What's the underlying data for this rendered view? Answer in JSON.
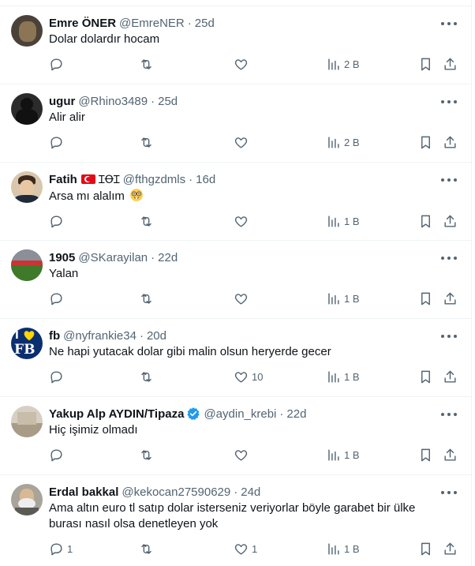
{
  "tweets": [
    {
      "name": "Emre ÖNER",
      "handle": "@EmreNER",
      "time": "25d",
      "text": "Dolar dolardır hocam",
      "replies": "",
      "retweets": "",
      "likes": "",
      "views": "2 B",
      "avatar_color": "#4a4238"
    },
    {
      "name": "ugur",
      "handle": "@Rhino3489",
      "time": "25d",
      "text": "Alir alir",
      "replies": "",
      "retweets": "",
      "likes": "",
      "views": "2 B",
      "avatar_color": "#2b2b2b"
    },
    {
      "name": "Fatih",
      "name_suffix": "ꞮꝊꞮ",
      "handle": "@fthgzdmls",
      "time": "16d",
      "text": "Arsa mı alalım",
      "replies": "",
      "retweets": "",
      "likes": "",
      "views": "1 B",
      "avatar_color": "#c9b59a"
    },
    {
      "name": "1905",
      "handle": "@SKarayilan",
      "time": "22d",
      "text": "Yalan",
      "replies": "",
      "retweets": "",
      "likes": "",
      "views": "1 B",
      "avatar_color": "#3e6b2f"
    },
    {
      "name": "fb",
      "handle": "@nyfrankie34",
      "time": "20d",
      "text": "Ne hapi yutacak dolar gibi malin olsun heryerde gecer",
      "replies": "",
      "retweets": "",
      "likes": "10",
      "views": "1 B",
      "avatar_color": "#0b2e6e",
      "avatar_text": "FB"
    },
    {
      "name": "Yakup Alp AYDIN/Tipaza",
      "handle": "@aydin_krebi",
      "time": "22d",
      "text": "Hiç işimiz olmadı",
      "replies": "",
      "retweets": "",
      "likes": "",
      "views": "1 B",
      "avatar_color": "#bfb7a8"
    },
    {
      "name": "Erdal bakkal",
      "handle": "@kekocan27590629",
      "time": "24d",
      "text": "Ama altın euro tl satıp dolar isterseniz veriyorlar böyle garabet bir ülke burası nasıl olsa denetleyen yok",
      "replies": "1",
      "retweets": "",
      "likes": "1",
      "views": "1 B",
      "avatar_color": "#a9a49a"
    }
  ],
  "colors": {
    "text": "#0f1419",
    "muted": "#536471",
    "border": "#eff3f4",
    "verified": "#1d9bf0"
  },
  "icons": [
    "reply-icon",
    "retweet-icon",
    "like-icon",
    "views-icon",
    "bookmark-icon",
    "share-icon",
    "more-icon",
    "verified-icon",
    "turkey-flag-icon",
    "nerd-face-emoji"
  ]
}
